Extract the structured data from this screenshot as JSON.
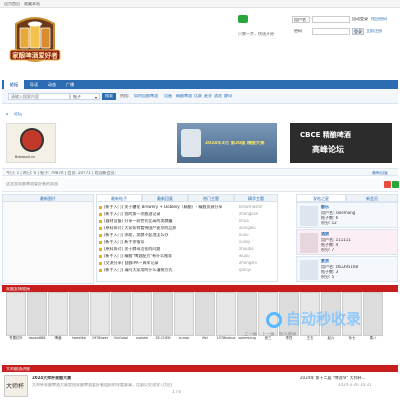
{
  "topbar": {
    "home": "设为首页",
    "fav": "收藏本站"
  },
  "logo": {
    "alt_text": "家酿啤酒爱好者"
  },
  "login": {
    "user_label": "用户名",
    "user_select": "用户名",
    "pass_label": "密码",
    "auto_login": "自动登录",
    "forgot": "找回密码",
    "login_btn": "登录",
    "register": "立即注册",
    "qq_hint": "只需一步，快速开始"
  },
  "nav": {
    "items": [
      "论坛",
      "导读",
      "动态",
      "广播"
    ]
  },
  "search": {
    "placeholder": "请输入搜索内容",
    "select": "帖子",
    "button": "搜索"
  },
  "hot": {
    "label": "热搜:",
    "items": [
      "如何自酿啤酒",
      "设备",
      "精酿啤酒",
      "比赛",
      "麦芽",
      "酒花",
      "酵母"
    ]
  },
  "crumb": {
    "text": "论坛"
  },
  "banners": {
    "b1": "Brewsvil.cn",
    "b2": "2024年3月 第20届 精酿大赛",
    "b3_title": "CBCE 精酿啤酒",
    "b3_sub": "高峰论坛"
  },
  "stats": {
    "text": "今日: 1 | 昨日: 0 | 帖子: 79870 | 会员: 20771 | 欢迎新会员:",
    "right": "最新回复"
  },
  "slogan": {
    "text": "这里是家酿啤酒爱好者的家园"
  },
  "columns": {
    "pics": "最新图片",
    "new": "最新帖子",
    "reply": "最新回复",
    "hotpost": "热门主题",
    "essence": "精华主题",
    "star": "发帖之星",
    "newuser": "新会员"
  },
  "news": [
    [
      "[新手入门] 关于糖化 Brewery + DobBey（精酿）- 精酿资源分享",
      "brewmaster"
    ],
    [
      "[新手入门] 我的第一次酿酒记录",
      "zhangsan"
    ],
    [
      "[器材设备] 分享一款性价比高的发酵罐",
      "lihua"
    ],
    [
      "[原料探讨] 大家如何看待国产麦芽的品质",
      "wangwu"
    ],
    [
      "[新手入门] 求助，发酵不起泡怎么办",
      "liuliu"
    ],
    [
      "[新手入门] 新手求指导",
      "sunqi"
    ],
    [
      "[原料探讨] 关于酵母活化的问题",
      "zhouba"
    ],
    [
      "[新手入门] 精酿\"啤酒配方\"有什么推荐",
      "wujiu"
    ],
    [
      "[交流分享] 自酿IPA一周年记录",
      "zhengshi"
    ],
    [
      "[新手入门] 请问大家用的什么灌装方式",
      "qianyi"
    ]
  ],
  "users": [
    {
      "name": "酿乐",
      "uid": "用户名: solemang",
      "posts": "帖子数: 6",
      "credits": "积分: 12"
    },
    {
      "name": "酒狼",
      "uid": "用户名: 111111",
      "posts": "帖子数: 4",
      "credits": "积分: 7"
    },
    {
      "name": "麦浪",
      "uid": "用户名: zhu395168",
      "posts": "帖子数: 3",
      "credits": "积分: 5"
    }
  ],
  "avatars": [
    "冬雪红叶",
    "davex888",
    "啤酒",
    "tweetka",
    "1978beer",
    "liluGatoi",
    "xueshe",
    "SE-CHEN",
    "zumar",
    "ffei",
    "1978hokua",
    "solemiang",
    "张三",
    "李四",
    "王五",
    "赵六",
    "孙七",
    "周八",
    "吴九"
  ],
  "redbar1": {
    "text": "家酿友情链接"
  },
  "redbar2": {
    "text": "大师酿酒讲座"
  },
  "bottom": {
    "title": "2024大师杯家酿大赛",
    "desc": "大师杯家酿啤酒大赛是由家酿啤酒爱好者组织的年度赛事，比赛以交流学习为目的...",
    "right_title": "2024年 第十二届 \"啤酒节\" 大师杯...",
    "date": "2024-3-26 16:31",
    "page": "1 / 6"
  },
  "watermark": {
    "text": "自动秒收录",
    "sub": "上一篇 · 下一篇 · 加入收录"
  },
  "colors": {
    "nav": "#2b6cb3",
    "red": "#c81d1d",
    "accent": "#e9f2fb"
  }
}
